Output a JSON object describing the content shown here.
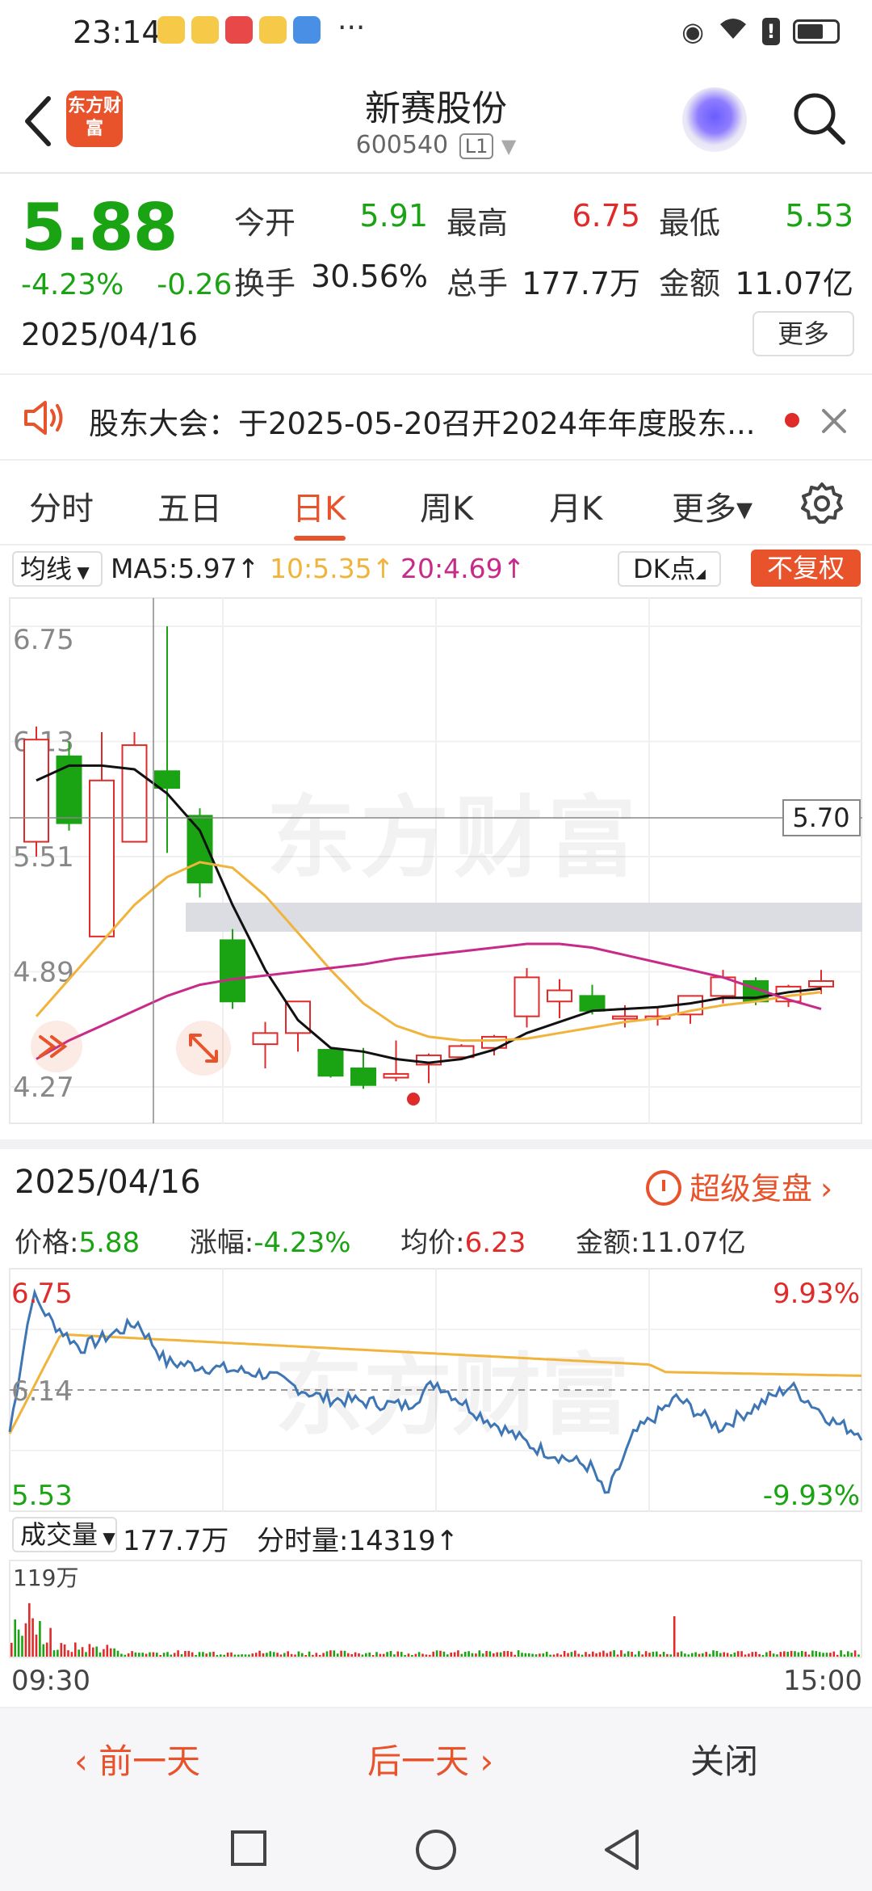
{
  "status_bar": {
    "time": "23:14",
    "more": "···"
  },
  "header": {
    "logo_text": "东方财富",
    "stock_name": "新赛股份",
    "stock_code": "600540",
    "level_tag": "L1"
  },
  "quote": {
    "price": "5.88",
    "change_pct": "-4.23%",
    "change_amt": "-0.26",
    "date": "2025/04/16",
    "open_label": "今开",
    "open": "5.91",
    "high_label": "最高",
    "high": "6.75",
    "low_label": "最低",
    "low": "5.53",
    "turnover_label": "换手",
    "turnover": "30.56%",
    "volume_label": "总手",
    "volume": "177.7万",
    "amount_label": "金额",
    "amount": "11.07亿",
    "more_button": "更多"
  },
  "notice": {
    "text": "股东大会：于2025-05-20召开2024年年度股东..."
  },
  "tabs": [
    {
      "label": "分时"
    },
    {
      "label": "五日"
    },
    {
      "label": "日K"
    },
    {
      "label": "周K"
    },
    {
      "label": "月K"
    },
    {
      "label": "更多▾"
    }
  ],
  "ma_bar": {
    "select": "均线",
    "ma5": "MA5:5.97↑",
    "ma10": "10:5.35↑",
    "ma20": "20:4.69↑",
    "dk": "DK点",
    "adjust": "不复权"
  },
  "kline": {
    "y_labels": [
      "6.75",
      "6.13",
      "5.51",
      "4.89",
      "4.27"
    ],
    "price_tag": "5.70",
    "watermark": "东方财富",
    "candles": [
      {
        "o": 5.59,
        "h": 6.21,
        "l": 5.51,
        "c": 6.14
      },
      {
        "o": 6.05,
        "h": 6.13,
        "l": 5.65,
        "c": 5.69
      },
      {
        "o": 5.08,
        "h": 6.18,
        "l": 5.08,
        "c": 5.92
      },
      {
        "o": 5.59,
        "h": 6.18,
        "l": 5.59,
        "c": 6.11
      },
      {
        "o": 5.97,
        "h": 6.75,
        "l": 5.53,
        "c": 5.88
      },
      {
        "o": 5.73,
        "h": 5.77,
        "l": 5.29,
        "c": 5.37
      },
      {
        "o": 5.06,
        "h": 5.12,
        "l": 4.69,
        "c": 4.73
      },
      {
        "o": 4.5,
        "h": 4.62,
        "l": 4.37,
        "c": 4.56
      },
      {
        "o": 4.56,
        "h": 4.64,
        "l": 4.46,
        "c": 4.73
      },
      {
        "o": 4.47,
        "h": 4.4,
        "l": 4.32,
        "c": 4.33
      },
      {
        "o": 4.37,
        "h": 4.48,
        "l": 4.26,
        "c": 4.28
      },
      {
        "o": 4.32,
        "h": 4.52,
        "l": 4.3,
        "c": 4.34
      },
      {
        "o": 4.39,
        "h": 4.45,
        "l": 4.29,
        "c": 4.44
      },
      {
        "o": 4.43,
        "h": 4.5,
        "l": 4.42,
        "c": 4.49
      },
      {
        "o": 4.48,
        "h": 4.55,
        "l": 4.44,
        "c": 4.54
      },
      {
        "o": 4.65,
        "h": 4.91,
        "l": 4.59,
        "c": 4.86
      },
      {
        "o": 4.73,
        "h": 4.85,
        "l": 4.64,
        "c": 4.79
      },
      {
        "o": 4.76,
        "h": 4.82,
        "l": 4.66,
        "c": 4.68
      },
      {
        "o": 4.65,
        "h": 4.71,
        "l": 4.59,
        "c": 4.65
      },
      {
        "o": 4.65,
        "h": 4.7,
        "l": 4.6,
        "c": 4.65
      },
      {
        "o": 4.66,
        "h": 4.71,
        "l": 4.61,
        "c": 4.76
      },
      {
        "o": 4.76,
        "h": 4.9,
        "l": 4.72,
        "c": 4.86
      },
      {
        "o": 4.84,
        "h": 4.86,
        "l": 4.71,
        "c": 4.73
      },
      {
        "o": 4.73,
        "h": 4.82,
        "l": 4.7,
        "c": 4.81
      },
      {
        "o": 4.81,
        "h": 4.9,
        "l": 4.77,
        "c": 4.84
      }
    ],
    "ma5": [
      5.92,
      6.0,
      6.0,
      5.98,
      5.85,
      5.65,
      5.25,
      4.9,
      4.63,
      4.48,
      4.46,
      4.42,
      4.4,
      4.42,
      4.47,
      4.56,
      4.62,
      4.68,
      4.69,
      4.7,
      4.72,
      4.75,
      4.75,
      4.78,
      4.8
    ],
    "ma10": [
      4.65,
      4.85,
      5.05,
      5.25,
      5.4,
      5.48,
      5.45,
      5.3,
      5.1,
      4.9,
      4.72,
      4.6,
      4.54,
      4.52,
      4.52,
      4.53,
      4.56,
      4.59,
      4.62,
      4.64,
      4.68,
      4.71,
      4.73,
      4.76,
      4.78
    ],
    "ma20": [
      4.42,
      4.52,
      4.6,
      4.68,
      4.76,
      4.82,
      4.85,
      4.87,
      4.89,
      4.91,
      4.93,
      4.96,
      4.98,
      5.0,
      5.02,
      5.04,
      5.04,
      5.02,
      4.98,
      4.94,
      4.9,
      4.86,
      4.8,
      4.74,
      4.69
    ]
  },
  "intraday": {
    "date": "2025/04/16",
    "replay": "超级复盘",
    "price_label": "价格:",
    "price": "5.88",
    "pct_label": "涨幅:",
    "pct": "-4.23%",
    "avg_label": "均价:",
    "avg": "6.23",
    "amount_label": "金额:",
    "amount": "11.07亿",
    "left_labels": [
      "6.75",
      "6.14",
      "5.53"
    ],
    "right_labels": [
      "9.93%",
      "-9.93%"
    ],
    "watermark": "东方财富"
  },
  "volume": {
    "select": "成交量",
    "total": "177.7万",
    "period": "分时量:14319↑",
    "max_label": "119万",
    "start_time": "09:30",
    "end_time": "15:00"
  },
  "actions": {
    "prev": "前一天",
    "next": "后一天",
    "close": "关闭"
  },
  "colors": {
    "up": "#e02b2b",
    "down": "#1aa313",
    "accent": "#e8532b",
    "ma5": "#111111",
    "ma10": "#f0b43c",
    "ma20": "#c82a8a"
  }
}
